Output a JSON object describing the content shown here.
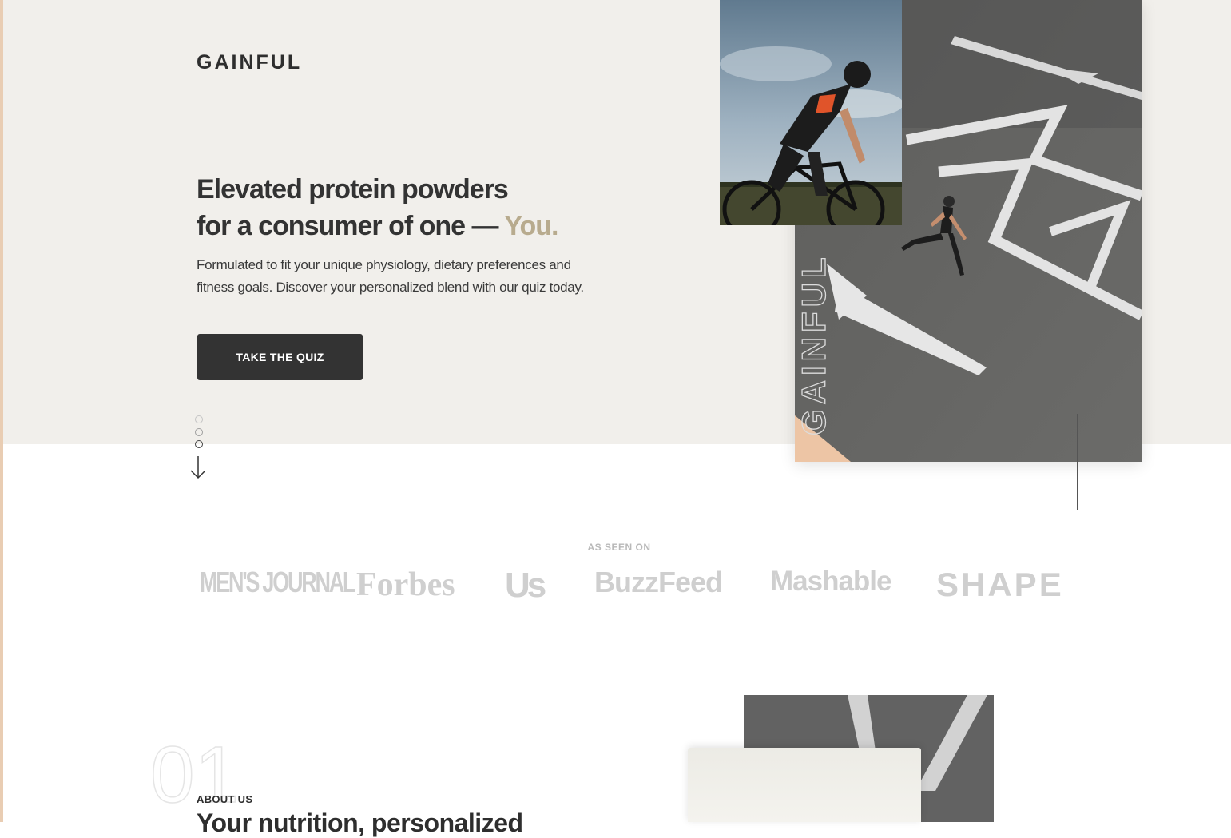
{
  "brand": {
    "logo": "GAINFUL",
    "accent_color": "#b8ab8e",
    "edge_color": "#e9cdb3"
  },
  "hero": {
    "headline_line1": "Elevated protein powders",
    "headline_line2_prefix": "for a consumer of one —",
    "headline_line2_accent": "You.",
    "subtext_line1": "Formulated to fit your unique physiology, dietary preferences and",
    "subtext_line2": "fitness goals. Discover your personalized blend with our quiz today.",
    "cta_label": "TAKE THE QUIZ",
    "photo_overlay_text": "GAINFUL",
    "background_color": "#f1efeb"
  },
  "press": {
    "label": "AS SEEN ON",
    "logos": [
      "MEN'S JOURNAL",
      "Forbes",
      "Us",
      "BuzzFeed",
      "Mashable",
      "SHAPE"
    ]
  },
  "about": {
    "number": "01",
    "label": "ABOUT US",
    "heading": "Your nutrition, personalized"
  },
  "icons": [
    "scroll-down-arrow-icon",
    "slide-indicator-dots"
  ]
}
